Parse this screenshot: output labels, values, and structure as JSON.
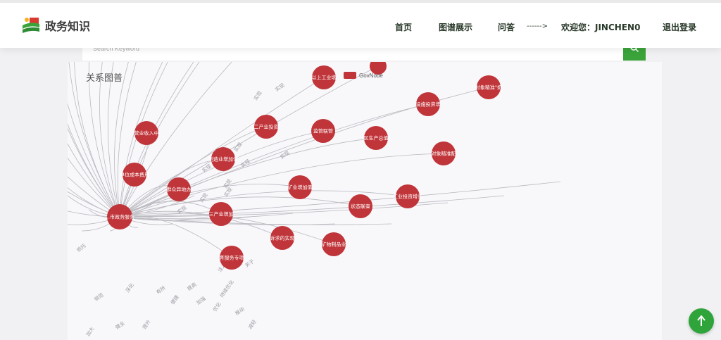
{
  "app": {
    "logo_text": "政务知识"
  },
  "nav": {
    "home": "首页",
    "graph": "图谱展示",
    "qa": "问答",
    "arrow": "------>",
    "welcome": "欢迎您：JINCHEN0",
    "logout": "退出登录"
  },
  "search": {
    "placeholder": "Search Keyword"
  },
  "panel": {
    "title": "关系图普"
  },
  "legend": {
    "label": "GovNode"
  },
  "colors": {
    "node": "#c0353a",
    "accent_green": "#3aa43a",
    "edge": "#b9b9bf"
  },
  "graph": {
    "hub": {
      "id": "hub",
      "label": "…市政务服务"
    },
    "nodes": [
      {
        "id": "n1",
        "label": "以上工业增"
      },
      {
        "id": "n2",
        "label": ""
      },
      {
        "id": "n3",
        "label": "对象精准\"奶"
      },
      {
        "id": "n4",
        "label": "设施投资增"
      },
      {
        "id": "n5",
        "label": "营业收入中"
      },
      {
        "id": "n6",
        "label": "二产业投资"
      },
      {
        "id": "n7",
        "label": "监管联管"
      },
      {
        "id": "n8",
        "label": "区生产总值"
      },
      {
        "id": "n9",
        "label": "对象精准配"
      },
      {
        "id": "n10",
        "label": "制造业增加值"
      },
      {
        "id": "n11",
        "label": "单位成本费用"
      },
      {
        "id": "n12",
        "label": "群众异地办"
      },
      {
        "id": "n13",
        "label": "矿业增加值"
      },
      {
        "id": "n14",
        "label": "工业投资增长"
      },
      {
        "id": "n15",
        "label": "状态联查"
      },
      {
        "id": "n16",
        "label": "三产业增加"
      },
      {
        "id": "n17",
        "label": "诉求的实现"
      },
      {
        "id": "n18",
        "label": "矿物制品业"
      },
      {
        "id": "n19",
        "label": "育服务专项"
      }
    ],
    "edge_labels": [
      "实现",
      "实现",
      "实现",
      "实现",
      "实现",
      "实现",
      "实现",
      "实现",
      "实现",
      "实现",
      "注入",
      "关于",
      "持续优化",
      "提高",
      "便捷",
      "加强",
      "优化",
      "推动",
      "减轻",
      "有所",
      "深化",
      "规范",
      "提升",
      "健全",
      "加大",
      "依托"
    ]
  }
}
